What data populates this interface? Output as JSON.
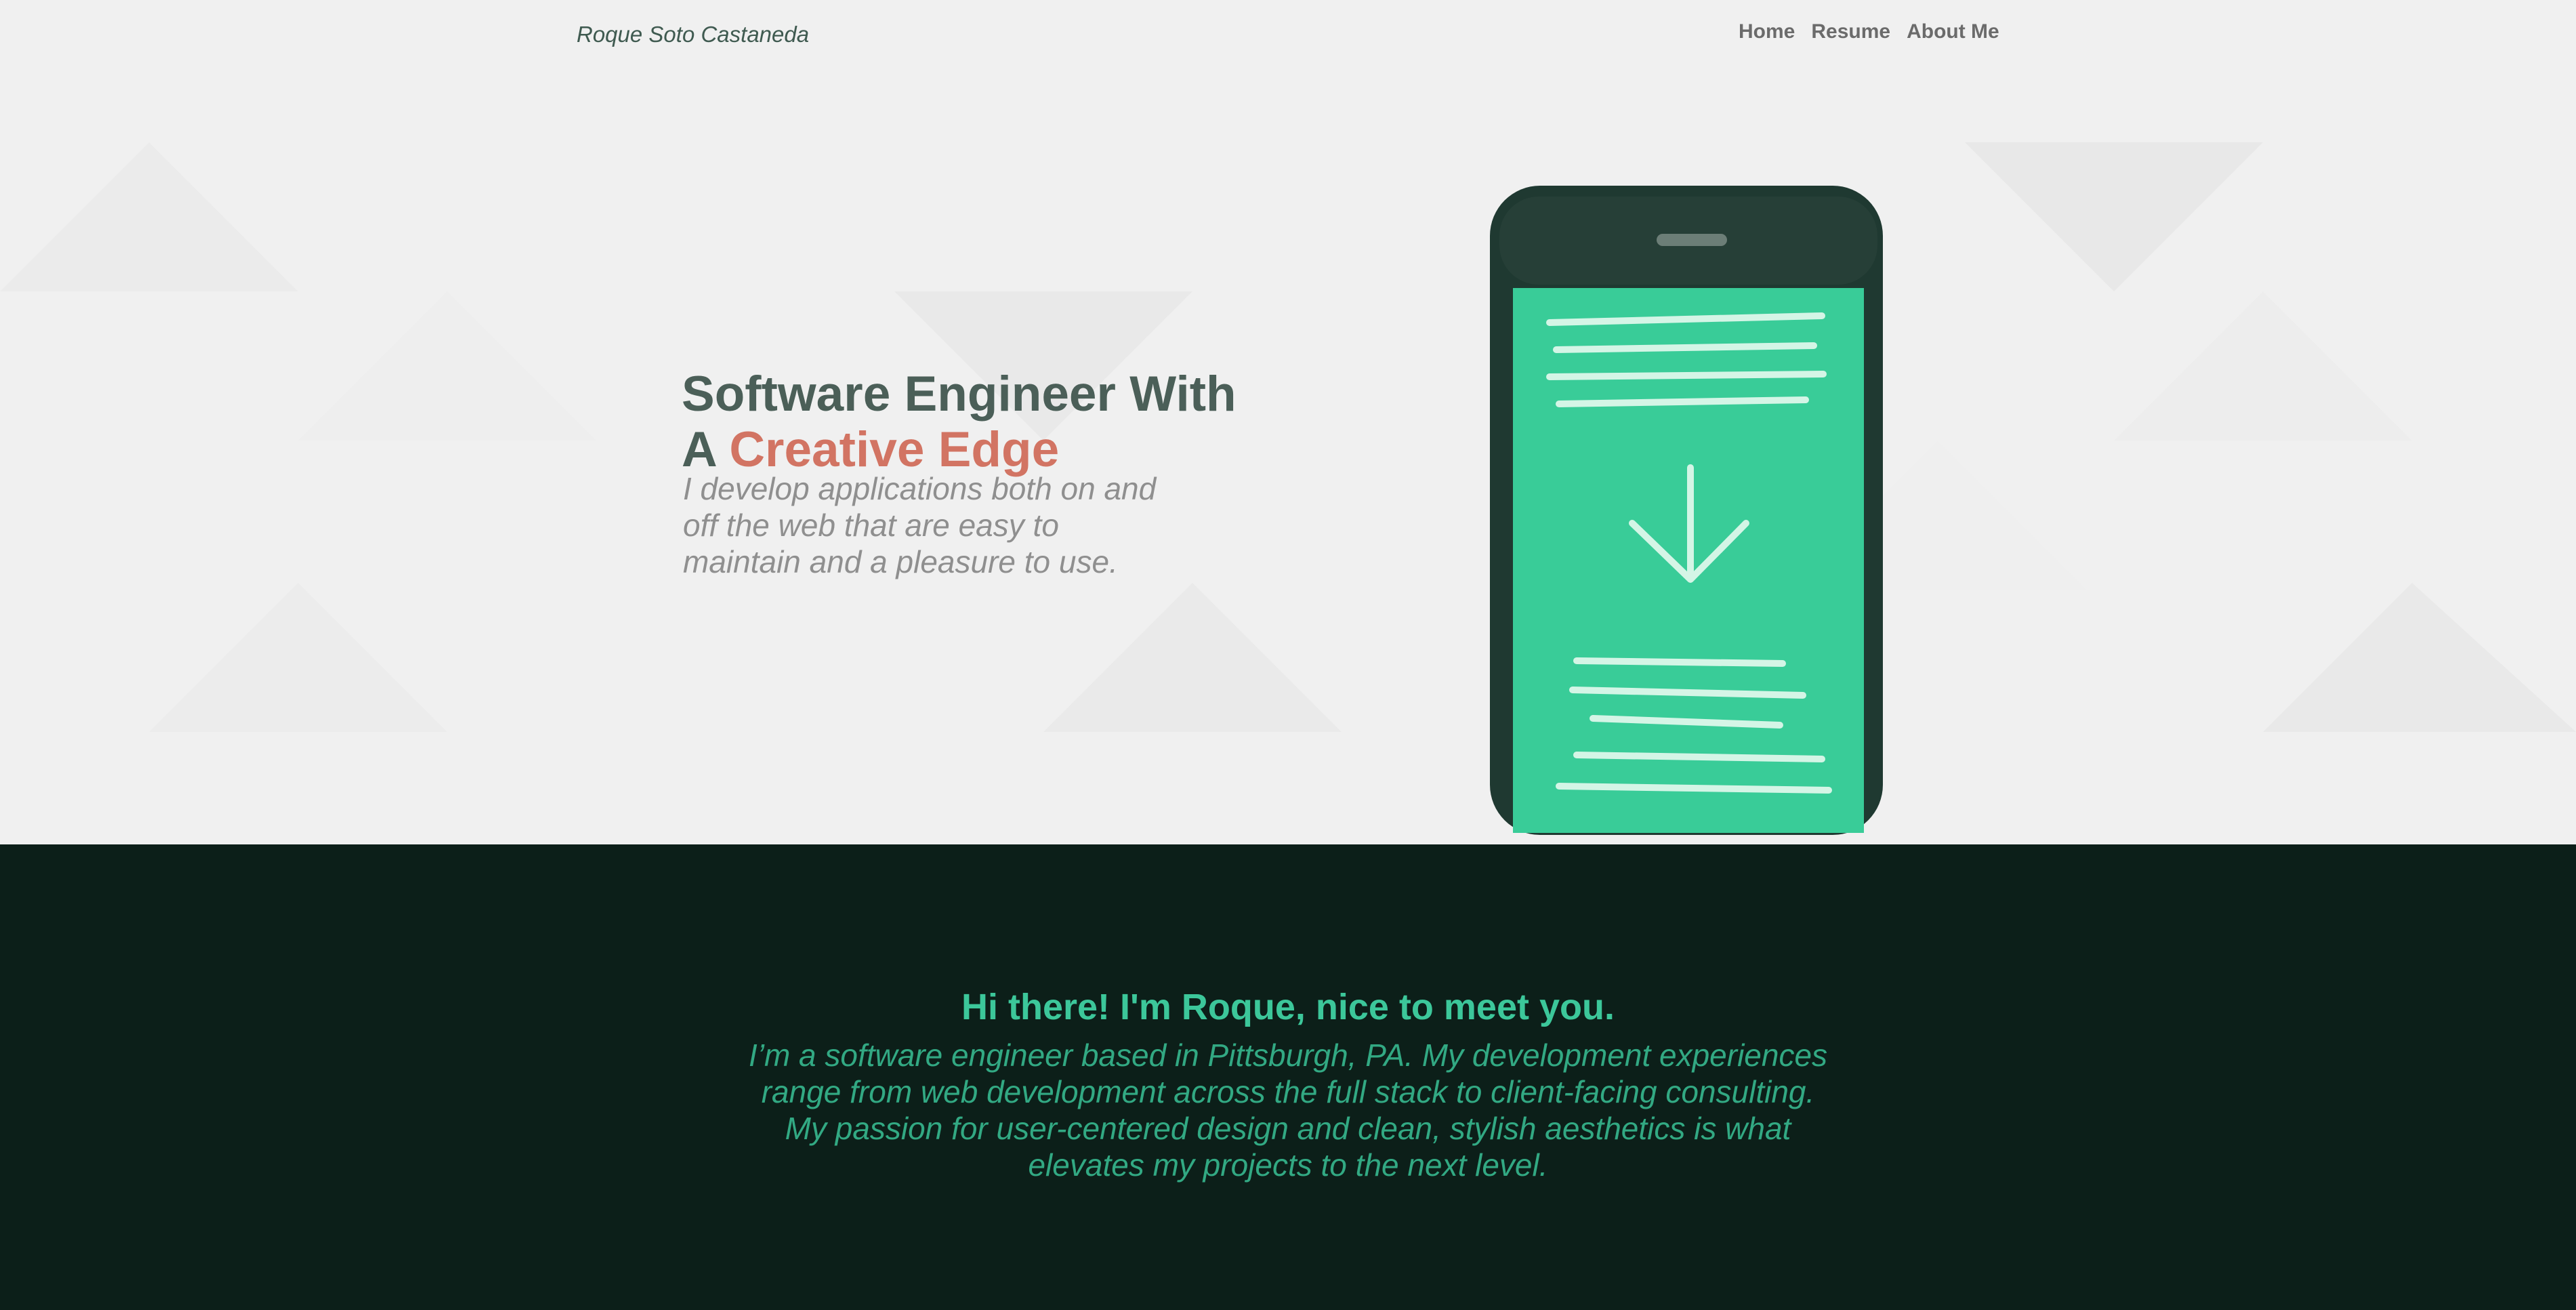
{
  "header": {
    "brand": "Roque Soto Castaneda",
    "nav": [
      {
        "label": "Home"
      },
      {
        "label": "Resume"
      },
      {
        "label": "About Me"
      }
    ]
  },
  "hero": {
    "headline_line1": "Software Engineer With",
    "headline_line2_prefix": "A",
    "headline_line2_accent": "Creative Edge",
    "tagline": "I develop applications both on and off the web that are easy to maintain and a pleasure to use.",
    "illustration_icon": "phone-download-icon"
  },
  "about": {
    "heading": "Hi there! I'm Roque, nice to meet you.",
    "body": "I’m a software engineer based in Pittsburgh, PA. My development experiences range from web development across the full stack to client-facing consulting. My passion for user-centered design and clean, stylish aesthetics is what elevates my projects to the next level."
  },
  "colors": {
    "hero_background": "#f0f0f0",
    "heading_text": "#4b5f58",
    "accent": "#d27463",
    "phone_screen": "#39cc98",
    "dark_section": "#0c1f19",
    "green_text": "#3cc79a"
  }
}
